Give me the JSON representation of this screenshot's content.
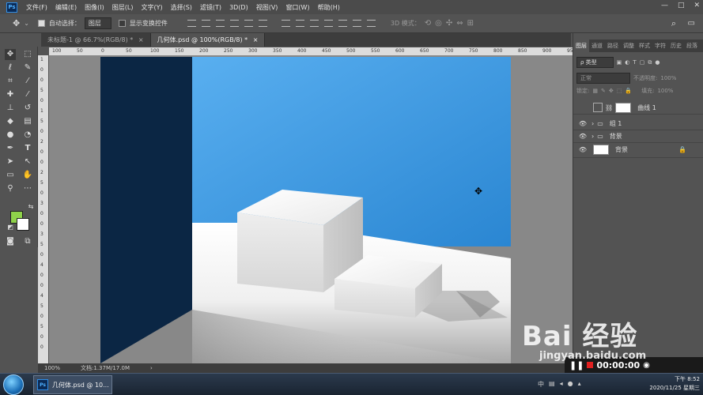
{
  "app": {
    "logo_text": "Ps"
  },
  "menu": [
    "文件(F)",
    "编辑(E)",
    "图像(I)",
    "图层(L)",
    "文字(Y)",
    "选择(S)",
    "滤镜(T)",
    "3D(D)",
    "视图(V)",
    "窗口(W)",
    "帮助(H)"
  ],
  "window_controls": [
    "—",
    "□",
    "✕"
  ],
  "options": {
    "auto_select_label": "自动选择：",
    "auto_select_value": "图层",
    "show_transform_label": "显示变换控件",
    "mode_3d_label": "3D 模式："
  },
  "doc_tabs": [
    {
      "label": "未标题-1 @ 66.7%(RGB/8) *",
      "close": "×"
    },
    {
      "label": "几何体.psd @ 100%(RGB/8) *",
      "close": "×"
    }
  ],
  "ruler_top": [
    "100",
    "50",
    "0",
    "50",
    "100",
    "150",
    "200",
    "250",
    "300",
    "350",
    "400",
    "450",
    "500",
    "550",
    "600",
    "650",
    "700",
    "750",
    "800",
    "850",
    "900",
    "950"
  ],
  "ruler_left": [
    "1",
    "0",
    "0",
    "5",
    "0",
    "1",
    "5",
    "0",
    "2",
    "0",
    "0",
    "2",
    "5",
    "0",
    "3",
    "0",
    "0",
    "3",
    "5",
    "0",
    "4",
    "0",
    "0",
    "4",
    "5",
    "0",
    "5",
    "0",
    "0"
  ],
  "status": {
    "zoom": "100%",
    "doc_info": "文档:1.37M/17.0M",
    "arrow": "›"
  },
  "panel": {
    "tabs": [
      "图层",
      "通道",
      "路径",
      "调整",
      "样式",
      "字符",
      "历史",
      "段落"
    ],
    "filter_label": "ρ 类型",
    "blend_mode": "正常",
    "opacity_label": "不透明度:",
    "opacity_value": "100%",
    "lock_label": "锁定:",
    "fill_label": "填充:",
    "fill_value": "100%",
    "layers": [
      {
        "name": "曲线 1",
        "type": "adjustment"
      },
      {
        "name": "组 1",
        "type": "group"
      },
      {
        "name": "背景",
        "type": "group"
      },
      {
        "name": "背景",
        "type": "background",
        "locked": true
      }
    ]
  },
  "taskbar": {
    "task_label": "几何体.psd @ 10...",
    "task_icon": "Ps",
    "time": "下午 8:52",
    "date": "2020/11/25 星期三"
  },
  "recorder": {
    "time": "00:00:00"
  },
  "watermark": {
    "main": "Bai  经验",
    "sub": "jingyan.baidu.com"
  },
  "colors": {
    "foreground": "#8fd24a",
    "background": "#ffffff",
    "wall_left": "#0b2644",
    "wall_back": "#3d97dd",
    "floor": "#f4f4f4"
  }
}
